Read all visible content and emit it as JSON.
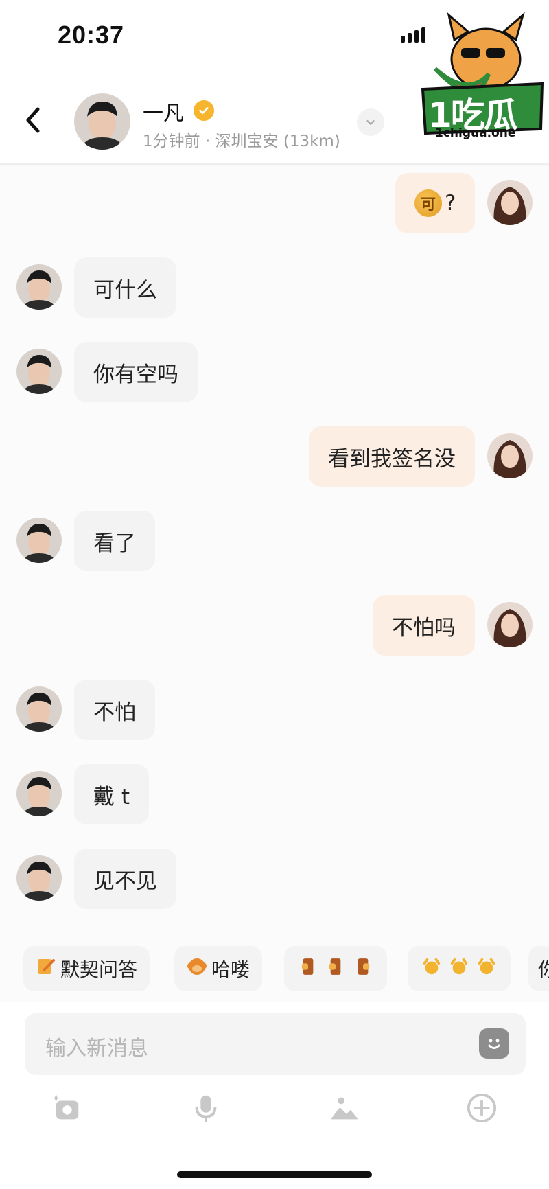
{
  "status_bar": {
    "time": "20:37"
  },
  "header": {
    "back_icon": "chevron-left-icon",
    "contact_name": "一凡",
    "verified_icon": "verified-badge-icon",
    "contact_status": "1分钟前 · 深圳宝安 (13km)",
    "dropdown_icon": "chevron-down-icon"
  },
  "watermark": {
    "brand": "1吃瓜",
    "url": "1chigua.one"
  },
  "messages": [
    {
      "side": "out",
      "text": "?",
      "has_coin": true,
      "coin_text": "可"
    },
    {
      "side": "in",
      "text": "可什么"
    },
    {
      "side": "in",
      "text": "你有空吗"
    },
    {
      "side": "out",
      "text": "看到我签名没"
    },
    {
      "side": "in",
      "text": "看了"
    },
    {
      "side": "out",
      "text": "不怕吗"
    },
    {
      "side": "in",
      "text": "不怕"
    },
    {
      "side": "in",
      "text": "戴 t"
    },
    {
      "side": "in",
      "text": "见不见"
    }
  ],
  "quick_replies": [
    {
      "label": "默契问答",
      "icon": "note-pencil-icon"
    },
    {
      "label": "哈喽",
      "icon": "monkey-emoji-icon"
    },
    {
      "label": "",
      "icon": "phone-emoji-icon"
    },
    {
      "label": "",
      "icon": "cheer-emoji-icon"
    },
    {
      "label": "你",
      "icon": ""
    }
  ],
  "input": {
    "placeholder": "输入新消息",
    "emoji_icon": "smiley-icon"
  },
  "toolbar": [
    {
      "icon": "camera-sparkle-icon"
    },
    {
      "icon": "microphone-icon"
    },
    {
      "icon": "image-icon"
    },
    {
      "icon": "plus-circle-icon"
    }
  ],
  "colors": {
    "incoming_bubble": "#f3f3f3",
    "outgoing_bubble": "#fdeee3",
    "verified": "#f6b52c",
    "watermark_green": "#2f8c3a"
  }
}
